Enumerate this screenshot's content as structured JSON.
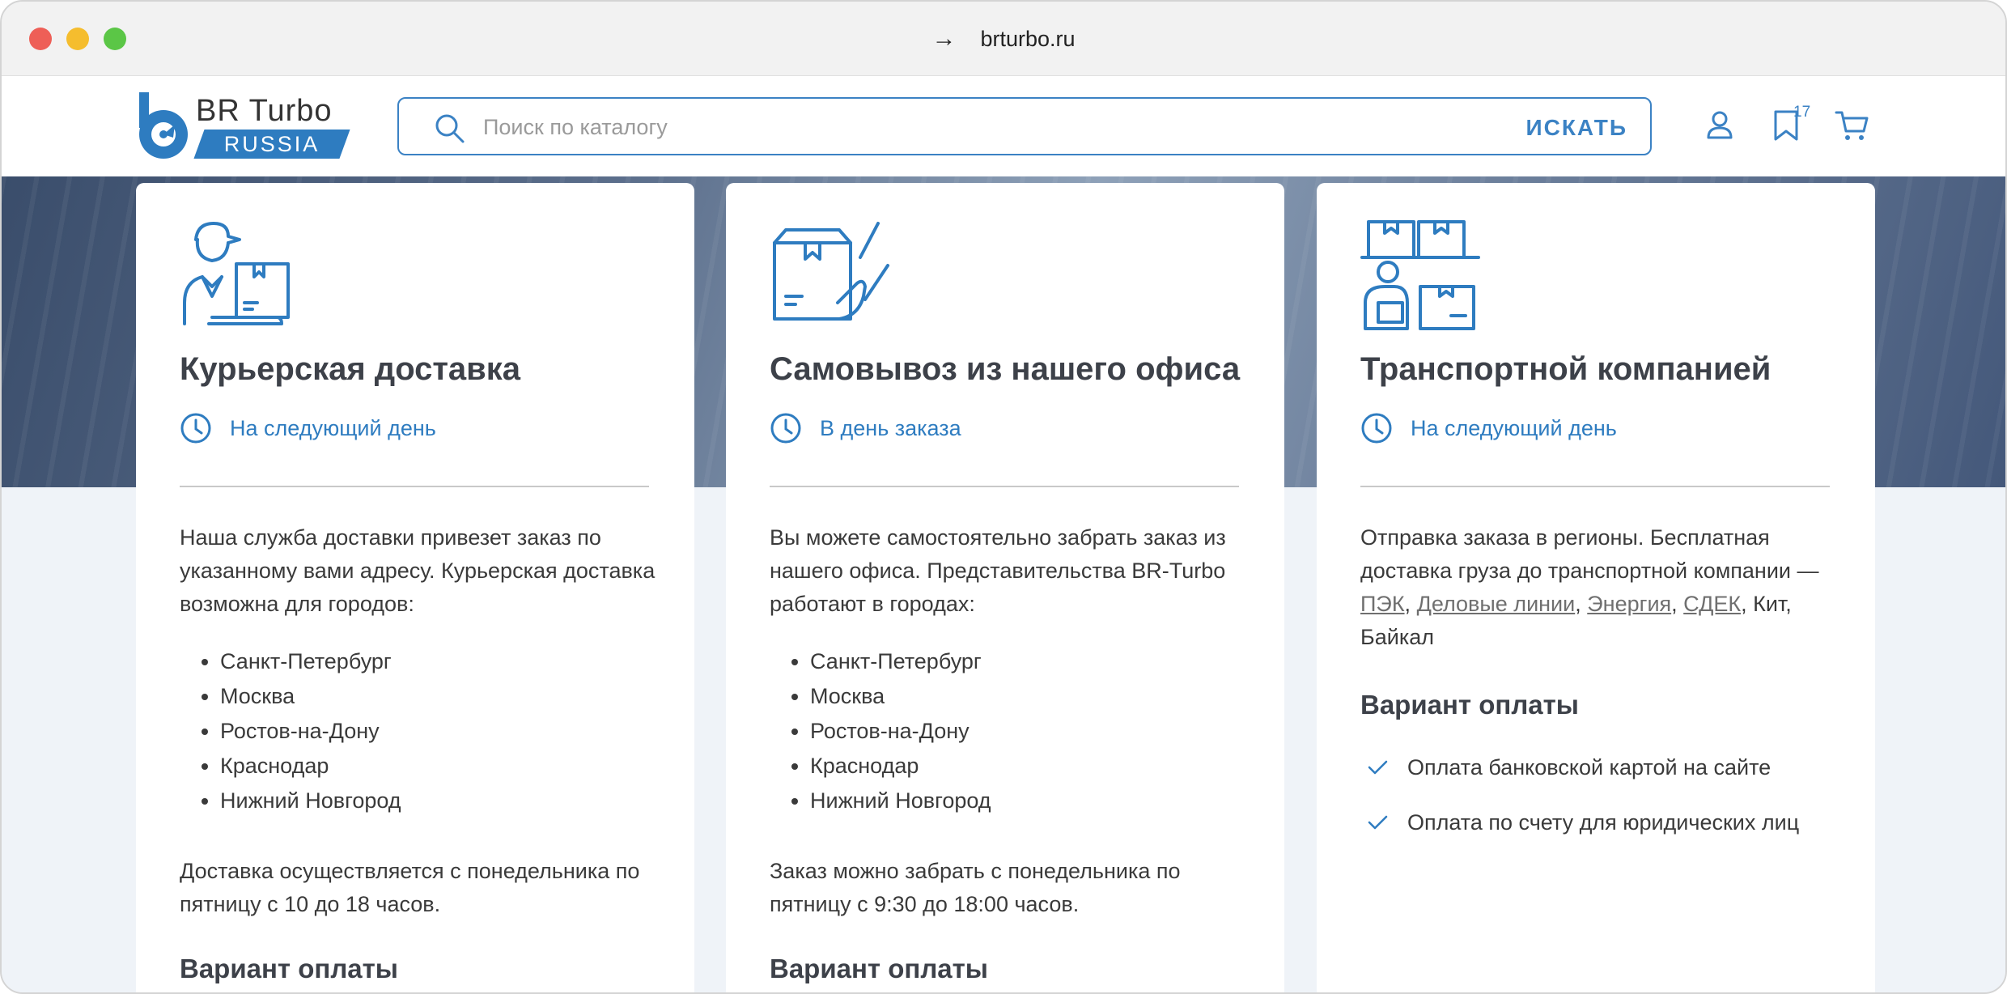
{
  "browser": {
    "url": "brturbo.ru",
    "nav_arrow": "→"
  },
  "header": {
    "logo": {
      "brand": "BR Turbo",
      "sub": "RUSSIA"
    },
    "search": {
      "placeholder": "Поиск по каталогу",
      "button": "ИСКАТЬ"
    },
    "bookmarks_count": "17"
  },
  "cards": [
    {
      "title": "Курьерская доставка",
      "time": "На следующий день",
      "description": "Наша служба доставки привезет заказ по указанному вами адресу. Курьерская доставка возможна для городов:",
      "cities": [
        "Санкт-Петербург",
        "Москва",
        "Ростов-на-Дону",
        "Краснодар",
        "Нижний Новгород"
      ],
      "hours": "Доставка осуществляется с понедельника по пятницу с 10 до 18 часов.",
      "payment_heading": "Вариант оплаты"
    },
    {
      "title": "Самовывоз из нашего офиса",
      "time": "В день заказа",
      "description": "Вы можете самостоятельно забрать заказ из нашего офиса. Представительства BR-Turbo работают в городах:",
      "cities": [
        "Санкт-Петербург",
        "Москва",
        "Ростов-на-Дону",
        "Краснодар",
        "Нижний Новгород"
      ],
      "hours": "Заказ можно забрать с понедельника по пятницу с 9:30 до 18:00 часов.",
      "payment_heading": "Вариант оплаты"
    },
    {
      "title": "Транспортной компанией",
      "time": "На следующий день",
      "description_prefix": "Отправка заказа в регионы. Бесплатная доставка груза до транспортной компании — ",
      "companies_links": [
        "ПЭК",
        "Деловые линии",
        "Энергия",
        "СДЕК"
      ],
      "companies_plain": "Кит, Байкал",
      "payment_heading": "Вариант оплаты",
      "payment_options": [
        "Оплата банковской картой на сайте",
        "Оплата по счету для юридических лиц"
      ]
    }
  ],
  "colors": {
    "accent": "#2e7cc0",
    "heading": "#3d4149"
  }
}
